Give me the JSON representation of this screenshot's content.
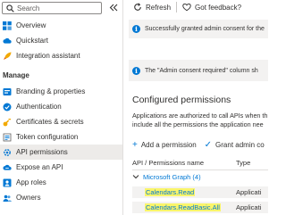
{
  "sidebar": {
    "search_placeholder": "Search",
    "items": [
      {
        "label": "Overview",
        "icon": "grid-icon"
      },
      {
        "label": "Quickstart",
        "icon": "cloud-icon"
      },
      {
        "label": "Integration assistant",
        "icon": "rocket-icon"
      }
    ],
    "manage_header": "Manage",
    "manage_items": [
      {
        "label": "Branding & properties",
        "icon": "branding-icon"
      },
      {
        "label": "Authentication",
        "icon": "authentication-icon"
      },
      {
        "label": "Certificates & secrets",
        "icon": "key-icon"
      },
      {
        "label": "Token configuration",
        "icon": "token-icon"
      },
      {
        "label": "API permissions",
        "icon": "api-permissions-icon",
        "selected": true
      },
      {
        "label": "Expose an API",
        "icon": "cloud-api-icon"
      },
      {
        "label": "App roles",
        "icon": "app-roles-icon"
      },
      {
        "label": "Owners",
        "icon": "owners-icon"
      }
    ]
  },
  "toolbar": {
    "refresh_label": "Refresh",
    "feedback_label": "Got feedback?"
  },
  "banners": [
    {
      "text": "Successfully granted admin consent for the"
    },
    {
      "text": "The \"Admin consent required\" column sh"
    }
  ],
  "main": {
    "section_title": "Configured permissions",
    "description_line1": "Applications are authorized to call APIs when th",
    "description_line2": "include all the permissions the application nee",
    "add_permission_label": "Add a permission",
    "grant_consent_label": "Grant admin co"
  },
  "table": {
    "col_name": "API / Permissions name",
    "col_type": "Type",
    "group_label": "Microsoft Graph (4)",
    "rows": [
      {
        "name": "Calendars.Read",
        "type": "Applicati"
      },
      {
        "name": "Calendars.ReadBasic.All",
        "type": "Applicati"
      }
    ]
  },
  "colors": {
    "accent": "#0078d4",
    "highlight": "#faf56a",
    "selected_bg": "#edebe9",
    "banner_bg": "#f3f2f1"
  }
}
